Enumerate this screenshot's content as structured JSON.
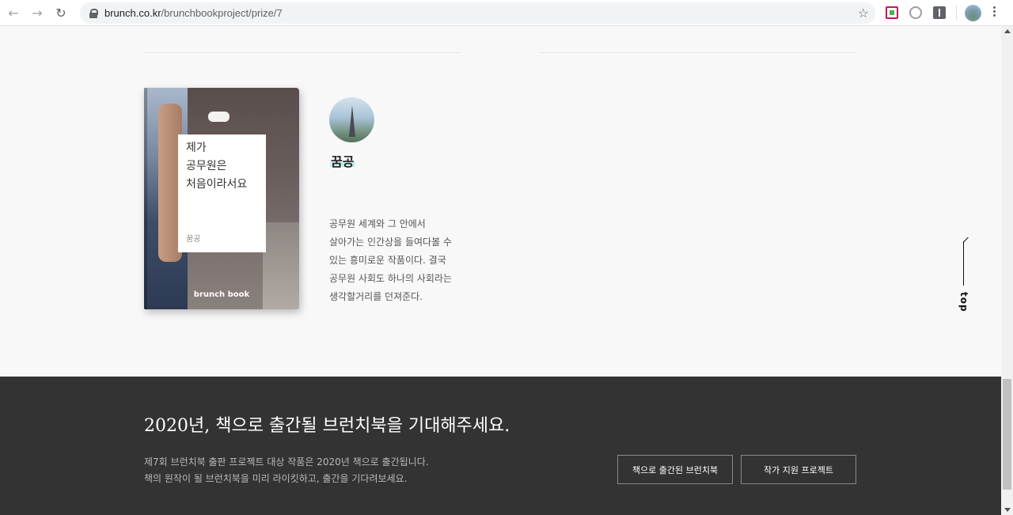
{
  "browser": {
    "url_domain": "brunch.co.kr",
    "url_path": "/brunchbookproject/prize/7",
    "back_icon": "←",
    "forward_icon": "→",
    "reload_icon": "↻",
    "star_icon": "☆"
  },
  "book": {
    "title_line1": "제가",
    "title_line2": "공무원은",
    "title_line3": "처음이라서요",
    "author": "꿈공",
    "brand": "brunch book"
  },
  "author_profile": {
    "name": "꿈공",
    "description": "공무원 세계와 그 안에서 살아가는 인간상을 들여다볼 수 있는 흥미로운 작품이다. 결국 공무원 사회도 하나의 사회라는 생각할거리를 던져준다."
  },
  "top_button": {
    "label": "top"
  },
  "footer": {
    "headline": "2020년, 책으로 출간될 브런치북을 기대해주세요.",
    "sub_line1": "제7회 브런치북 출판 프로젝트 대상 작품은 2020년 책으로 출간됩니다.",
    "sub_line2": "책의 원작이 될 브런치북을 미리 라이킷하고, 출간을 기다려보세요.",
    "button_published": "책으로 출간된 브런치북",
    "button_support": "작가 지원 프로젝트"
  }
}
